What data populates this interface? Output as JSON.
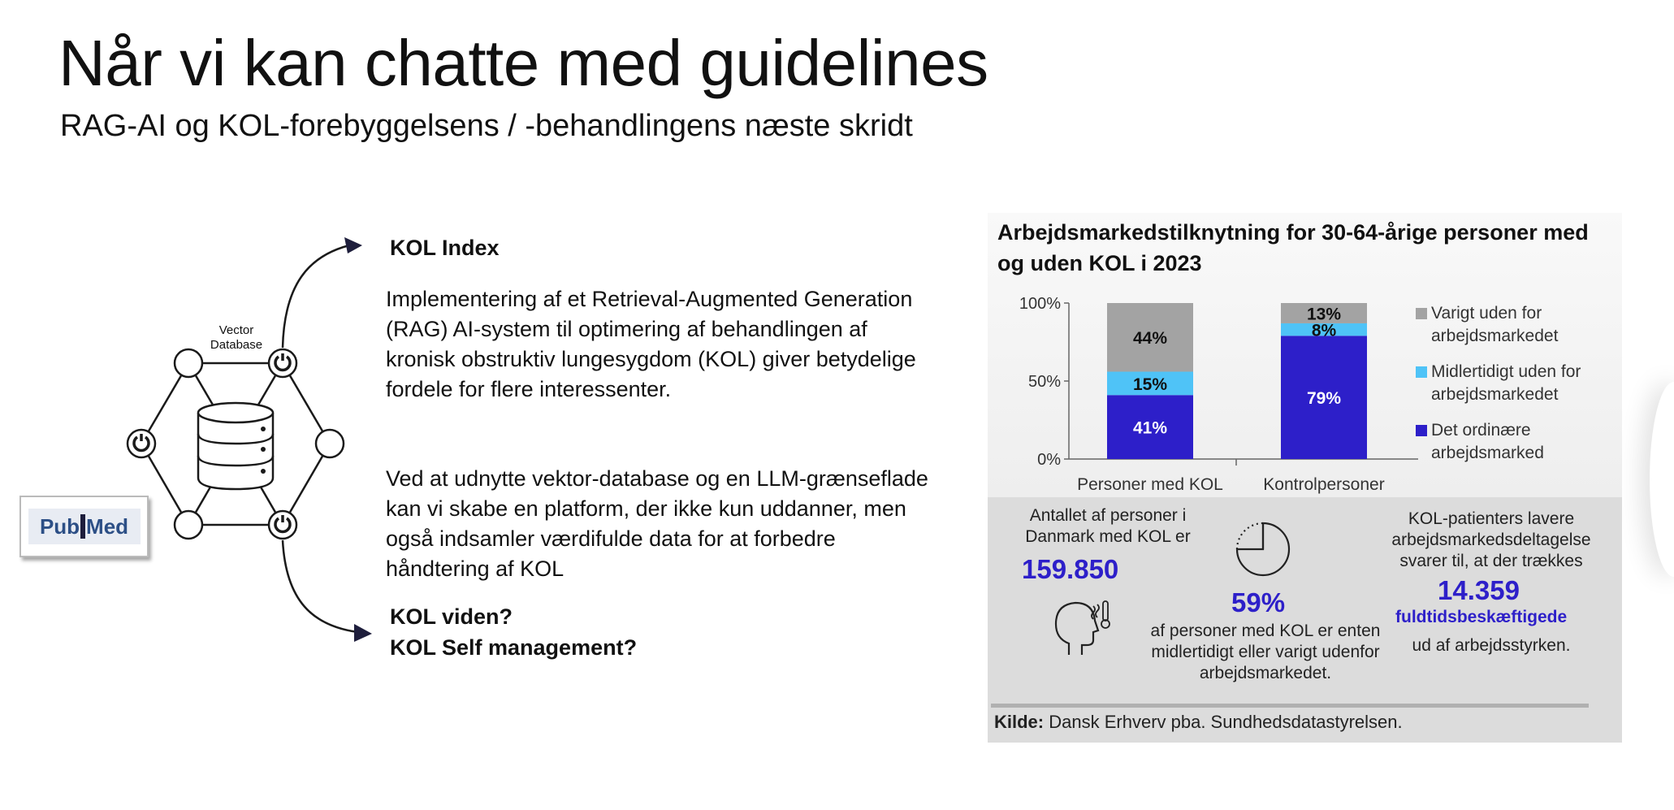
{
  "slide": {
    "title": "Når vi kan chatte med guidelines",
    "subtitle": "RAG-AI og KOL-forebyggelsens / -behandlingens næste skridt"
  },
  "diagram": {
    "db_label_line1": "Vector",
    "db_label_line2": "Database",
    "logo_text_left": "Pub",
    "logo_text_right": "Med",
    "arrow_top_label": "KOL Index",
    "arrow_bottom_label_1": "KOL viden?",
    "arrow_bottom_label_2": "KOL Self management?"
  },
  "body": {
    "paragraph_1": "Implementering af et Retrieval-Augmented Generation (RAG) AI-system til optimering af behandlingen af kronisk obstruktiv lungesygdom (KOL) giver betydelige fordele for flere interessenter.",
    "paragraph_2": "Ved at udnytte vektor-database og en LLM-grænseflade kan vi skabe en platform, der ikke kun uddanner, men også indsamler værdifulde data for at forbedre håndtering af KOL"
  },
  "chart_data": {
    "type": "bar",
    "stacked": true,
    "title": "Arbejdsmarkedstilknytning for 30-64-årige personer med og uden KOL i 2023",
    "categories": [
      "Personer med KOL",
      "Kontrolpersoner"
    ],
    "series": [
      {
        "name": "Det ordinære arbejdsmarked",
        "values": [
          41,
          79
        ],
        "labels": [
          "41%",
          "79%"
        ],
        "color": "#2d1fc9"
      },
      {
        "name": "Midlertidigt uden for arbejdsmarkedet",
        "values": [
          15,
          8
        ],
        "labels": [
          "15%",
          "8%"
        ],
        "color": "#4fc3f7"
      },
      {
        "name": "Varigt uden for arbejdsmarkedet",
        "values": [
          44,
          13
        ],
        "labels": [
          "44%",
          "13%"
        ],
        "color": "#a3a3a3"
      }
    ],
    "yticks": [
      "100%",
      "50%",
      "0%"
    ],
    "ylim": [
      0,
      100
    ],
    "legend_position": "right"
  },
  "stats": {
    "count_intro": "Antallet af personer i Danmark med KOL er",
    "count_value": "159.850",
    "share_value": "59%",
    "share_text": "af personer med KOL er enten midlertidigt eller varigt udenfor arbejdsmarkedet.",
    "fte_intro": "KOL-patienters lavere arbejdsmarkedsdeltagelse svarer til, at der trækkes",
    "fte_value": "14.359",
    "fte_unit": "fuldtidsbeskæftigede",
    "fte_outro": "ud af arbejdsstyrken.",
    "icons": [
      "person-fever-icon",
      "pie-clock-icon"
    ]
  },
  "source": {
    "label": "Kilde:",
    "text": "Dansk Erhverv pba. Sundhedsdatastyrelsen."
  }
}
